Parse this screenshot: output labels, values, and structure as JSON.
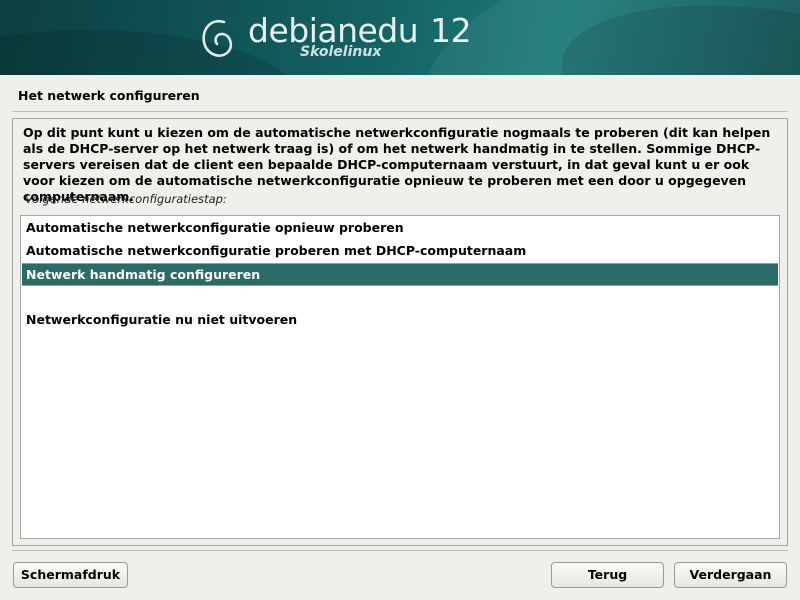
{
  "header": {
    "brand": "debianedu",
    "version": "12",
    "subtitle": "Skolelinux",
    "accent_color": "#136062"
  },
  "page": {
    "title": "Het netwerk configureren"
  },
  "content": {
    "intro_text": "Op dit punt kunt u kiezen om de automatische netwerkconfiguratie nogmaals te proberen (dit kan helpen als de DHCP-server op het netwerk traag is) of om het netwerk handmatig in te stellen. Sommige DHCP-servers vereisen dat de client een bepaalde DHCP-computernaam verstuurt, in dat geval kunt u er ook voor kiezen om de automatische netwerkconfiguratie opnieuw te proberen met een door u opgegeven computernaam.",
    "list_prompt": "Volgende netwerkconfiguratiestap:",
    "options": [
      {
        "label": "Automatische netwerkconfiguratie opnieuw proberen",
        "selected": false
      },
      {
        "label": "Automatische netwerkconfiguratie proberen met DHCP-computernaam",
        "selected": false
      },
      {
        "label": "Netwerk handmatig configureren",
        "selected": true
      },
      {
        "label": "",
        "selected": false
      },
      {
        "label": "Netwerkconfiguratie nu niet uitvoeren",
        "selected": false
      }
    ],
    "selection_color": "#2a6b68"
  },
  "footer": {
    "screenshot_label": "Schermafdruk",
    "back_label": "Terug",
    "continue_label": "Verdergaan"
  }
}
